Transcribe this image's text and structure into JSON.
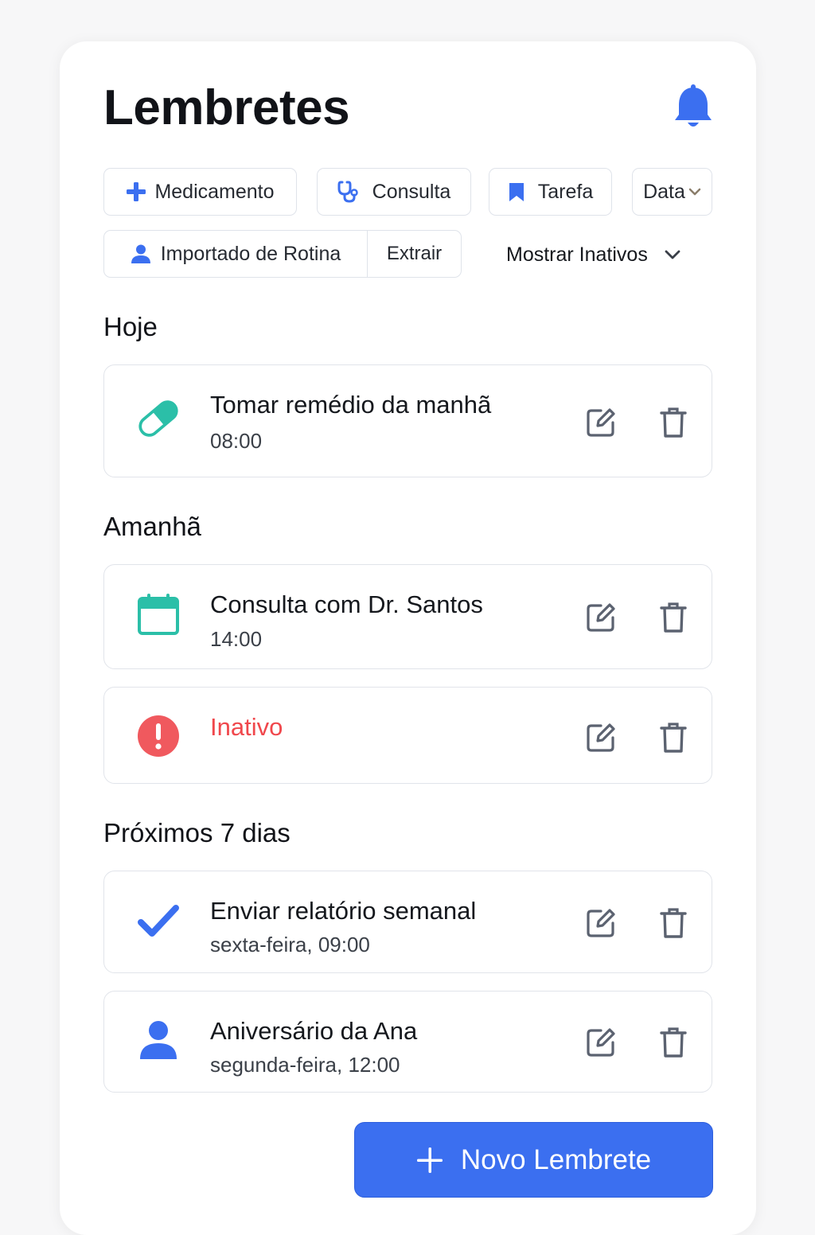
{
  "header": {
    "title": "Lembretes",
    "notifications_icon": "bell-icon"
  },
  "filters": {
    "medicamento": "Medicamento",
    "consulta": "Consulta",
    "tarefa": "Tarefa",
    "data": "Data",
    "importado": "Importado de Rotina",
    "extrair": "Extrair",
    "mostrar_inativos": "Mostrar Inativos"
  },
  "sections": {
    "hoje": "Hoje",
    "amanha": "Amanhã",
    "proximos": "Próximos 7 dias"
  },
  "reminders": [
    {
      "title": "Tomar remédio da manhã",
      "time": "08:00",
      "icon": "pill-icon"
    },
    {
      "title": "Consulta com Dr. Santos",
      "time": "14:00",
      "icon": "calendar-icon"
    },
    {
      "title": "Inativo",
      "icon": "alert-icon"
    },
    {
      "title": "Enviar relatório semanal",
      "time": "sexta-feira, 09:00",
      "icon": "check-icon"
    },
    {
      "title": "Aniversário da Ana",
      "time": "segunda-feira, 12:00",
      "icon": "person-icon"
    }
  ],
  "new_button": "Novo Lembrete",
  "colors": {
    "accent": "#3b6ff0",
    "teal": "#2bbfa8",
    "danger": "#f0474c",
    "icon_gray": "#5b6270"
  }
}
